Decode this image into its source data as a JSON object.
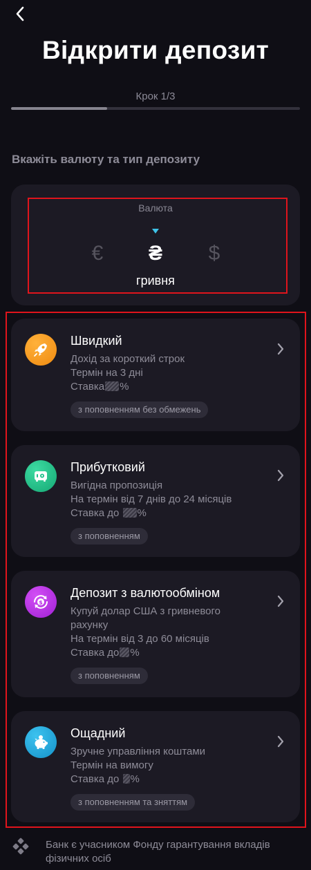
{
  "header": {
    "title": "Відкрити депозит",
    "step": "Крок 1/3",
    "progress": 0.333,
    "back_icon": "chevron-left-icon"
  },
  "section_heading": "Вкажіть валюту та тип депозиту",
  "currency": {
    "label": "Валюта",
    "options": [
      "€",
      "₴",
      "$"
    ],
    "selected_index": 1,
    "selected_name": "гривня",
    "indicator_color": "#3fc3e8"
  },
  "deposits": [
    {
      "title": "Швидкий",
      "line1": "Дохід за короткий строк",
      "line2": "Термін на 3 дні",
      "rate_prefix": "Ставка",
      "rate_suffix": "%",
      "badge": "з поповненням без обмежень",
      "icon": "rocket-icon",
      "icon_color": "#f29a1c"
    },
    {
      "title": "Прибутковий",
      "line1": "Вигідна пропозиція",
      "line2": "На термін від 7 днів до 24 місяців",
      "rate_prefix": "Ставка до",
      "rate_suffix": "%",
      "badge": "з поповненням",
      "icon": "safe-icon",
      "icon_color": "#1ec28b"
    },
    {
      "title": "Депозит з валютообміном",
      "line1": "Купуй долар США з гривневого",
      "line1b": "рахунку",
      "line2": "На термін від 3 до 60 місяців",
      "rate_prefix": "Ставка до",
      "rate_suffix": "%",
      "badge": "з поповненням",
      "icon": "currency-exchange-icon",
      "icon_color": "#b82ee6"
    },
    {
      "title": "Ощадний",
      "line1": "Зручне управління коштами",
      "line2": "Термін на вимогу",
      "rate_prefix": "Ставка до",
      "rate_suffix": "%",
      "badge": "з поповненням та зняттям",
      "icon": "piggy-bank-icon",
      "icon_color": "#1fa6dc"
    }
  ],
  "footer": {
    "icon": "guarantee-fund-icon",
    "text": "Банк є учасником Фонду гарантування вкладів фізичних осіб"
  },
  "colors": {
    "background": "#0f0e15",
    "card": "#1c1a24",
    "muted_text": "#8e8c98",
    "highlight_border": "#e0141c"
  }
}
